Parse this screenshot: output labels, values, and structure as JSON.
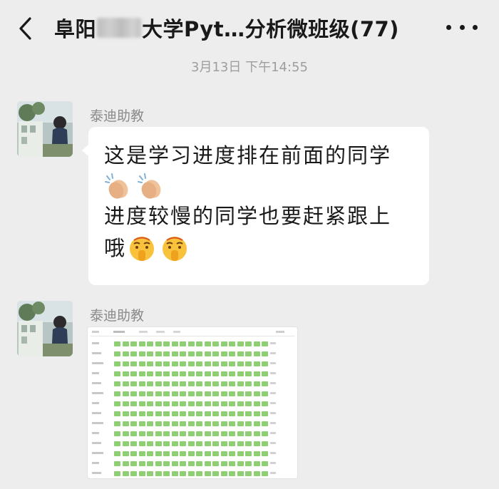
{
  "header": {
    "title_prefix": "阜阳",
    "title_suffix": "大学Pyt…分析微班级(77)"
  },
  "timestamp": "3月13日 下午14:55",
  "messages": [
    {
      "sender": "泰迪助教",
      "lines": [
        "这是学习进度排在前面的同学",
        "进度较慢的同学也要赶紧跟上",
        "哦"
      ],
      "emoji_1": "clapping-hands",
      "emoji_2": "shushing-face"
    },
    {
      "sender": "泰迪助教",
      "type": "image",
      "image": "learning-progress-table-screenshot"
    }
  ],
  "colors": {
    "background": "#ededed",
    "bubble": "#ffffff",
    "progress_green": "#8fcf73",
    "sender_gray": "#8a8a8a"
  }
}
